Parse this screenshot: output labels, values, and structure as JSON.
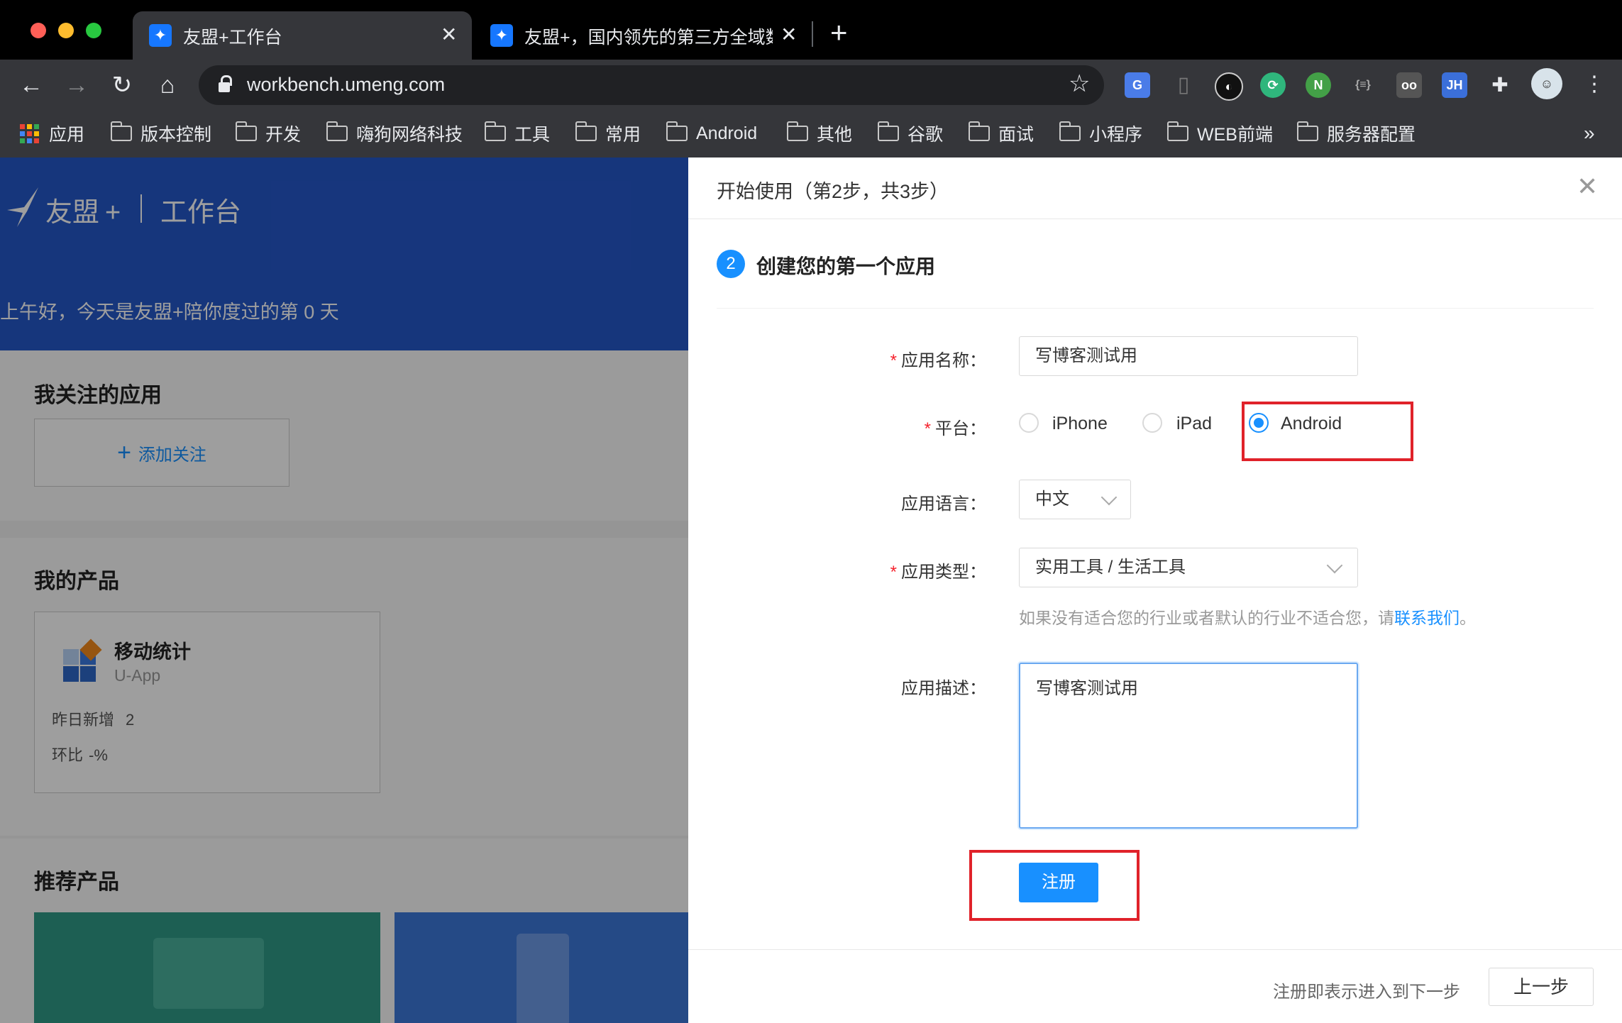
{
  "browser": {
    "tabs": [
      {
        "title": "友盟+工作台"
      },
      {
        "title": "友盟+，国内领先的第三方全域数"
      }
    ],
    "url": "workbench.umeng.com",
    "extensions": [
      "translate-ext",
      "bookmark-ext",
      "dark-ext",
      "sync-ext",
      "node-ext",
      "json-ext",
      "reader-ext",
      "jh-ext",
      "puzzle-ext",
      "profile-avatar"
    ],
    "bookmarks": [
      {
        "label": "应用",
        "type": "apps"
      },
      {
        "label": "版本控制",
        "type": "folder"
      },
      {
        "label": "开发",
        "type": "folder"
      },
      {
        "label": "嗨狗网络科技",
        "type": "folder"
      },
      {
        "label": "工具",
        "type": "folder"
      },
      {
        "label": "常用",
        "type": "folder"
      },
      {
        "label": "Android",
        "type": "folder"
      },
      {
        "label": "其他",
        "type": "folder"
      },
      {
        "label": "谷歌",
        "type": "folder"
      },
      {
        "label": "面试",
        "type": "folder"
      },
      {
        "label": "小程序",
        "type": "folder"
      },
      {
        "label": "WEB前端",
        "type": "folder"
      },
      {
        "label": "服务器配置",
        "type": "folder"
      }
    ],
    "overflow": "»"
  },
  "page": {
    "brand": "友盟",
    "brand_plus": "+",
    "brand_sub": "工作台",
    "greeting": "上午好，今天是友盟+陪你度过的第 0 天",
    "followed_title": "我关注的应用",
    "add_follow": "添加关注",
    "products_title": "我的产品",
    "product": {
      "name": "移动统计",
      "sub": "U-App",
      "new_label": "昨日新增",
      "new_value": "2",
      "ratio_label": "环比",
      "ratio_value": "-%"
    },
    "recommend_title": "推荐产品"
  },
  "drawer": {
    "title": "开始使用（第2步，共3步）",
    "step_num": "2",
    "step_title": "创建您的第一个应用",
    "fields": {
      "name_label": "应用名称：",
      "name_value": "写博客测试用",
      "platform_label": "平台：",
      "platform_options": [
        "iPhone",
        "iPad",
        "Android"
      ],
      "platform_selected": "Android",
      "lang_label": "应用语言：",
      "lang_value": "中文",
      "type_label": "应用类型：",
      "type_value": "实用工具 / 生活工具",
      "hint_prefix": "如果没有适合您的行业或者默认的行业不适合您，请",
      "hint_link": "联系我们",
      "hint_suffix": "。",
      "desc_label": "应用描述：",
      "desc_value": "写博客测试用"
    },
    "register_button": "注册",
    "footer_note": "注册即表示进入到下一步",
    "prev_button": "上一步"
  },
  "colors": {
    "primary": "#1890ff",
    "hero": "#2557c9",
    "highlight": "#e0222a",
    "required": "#f5222d"
  }
}
